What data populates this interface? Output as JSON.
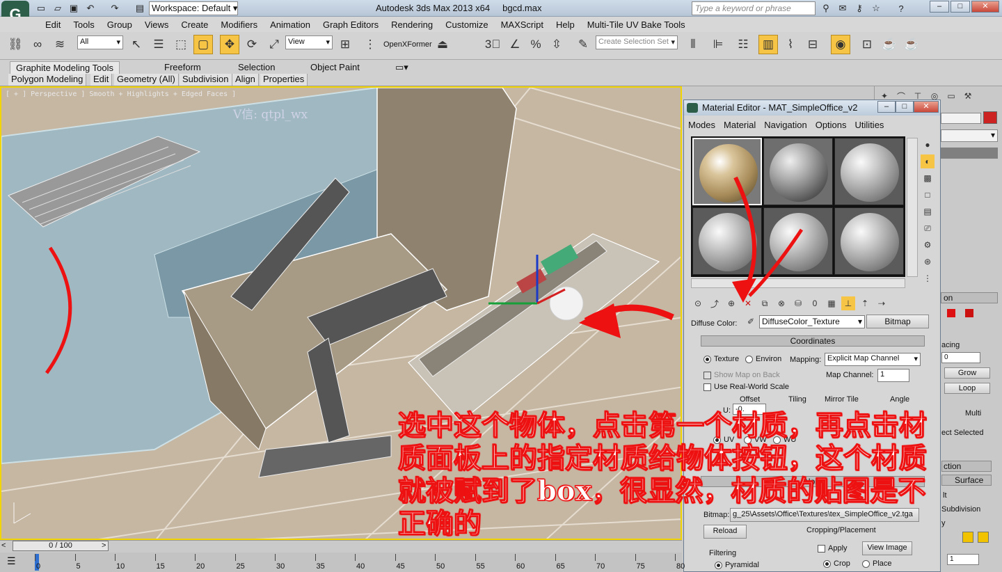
{
  "titlebar": {
    "workspace": "Workspace: Default",
    "app_title": "Autodesk 3ds Max  2013 x64",
    "file_name": "bgcd.max",
    "search_placeholder": "Type a keyword or phrase"
  },
  "menubar": [
    "Edit",
    "Tools",
    "Group",
    "Views",
    "Create",
    "Modifiers",
    "Animation",
    "Graph Editors",
    "Rendering",
    "Customize",
    "MAXScript",
    "Help",
    "Multi-Tile UV Bake Tools"
  ],
  "toolbar": {
    "selection_filter": "All",
    "ref_coord": "View",
    "openxformer": "OpenXFormer",
    "named_selection_placeholder": "Create Selection Set"
  },
  "ribbon": {
    "tabs": [
      "Graphite Modeling Tools",
      "Freeform",
      "Selection",
      "Object Paint"
    ],
    "subtabs": [
      "Polygon Modeling",
      "Edit",
      "Geometry (All)",
      "Subdivision",
      "Align",
      "Properties"
    ]
  },
  "viewport": {
    "label": "[ + ] Perspective ] Smooth + Highlights + Edged Faces ]",
    "watermark": "V信: qtpl_wx"
  },
  "material_editor": {
    "title": "Material Editor - MAT_SimpleOffice_v2",
    "menu": [
      "Modes",
      "Material",
      "Navigation",
      "Options",
      "Utilities"
    ],
    "diffuse_label": "Diffuse Color:",
    "map_name": "DiffuseColor_Texture",
    "map_type": "Bitmap",
    "coordinates_rollout": "Coordinates",
    "texture_label": "Texture",
    "environ_label": "Environ",
    "mapping_label": "Mapping:",
    "mapping_value": "Explicit Map Channel",
    "show_map_on_back": "Show Map on Back",
    "use_real_world": "Use Real-World Scale",
    "map_channel_label": "Map Channel:",
    "map_channel_value": "1",
    "col_offset": "Offset",
    "col_tiling": "Tiling",
    "col_mirror_tile": "Mirror Tile",
    "col_angle": "Angle",
    "u_label": "U:",
    "u_offset": "-0.",
    "uv_label": "UV",
    "vw_label": "VW",
    "wu_label": "WU",
    "noise_rollout": "Nois",
    "bitmap_label": "Bitmap:",
    "bitmap_path": "g_25\\Assets\\Office\\Textures\\tex_SimpleOffice_v2.tga",
    "reload_button": "Reload",
    "cropping_label": "Cropping/Placement",
    "apply_label": "Apply",
    "view_image_button": "View Image",
    "crop_label": "Crop",
    "place_label": "Place",
    "filtering_label": "Filtering",
    "pyramidal_label": "Pyramidal"
  },
  "command_panel": {
    "spacing_label": "acing",
    "spin_value": "0",
    "grow_button": "Grow",
    "loop_button": "Loop",
    "multi_label": "Multi",
    "ect_selected": "ect Selected",
    "section_a": "on",
    "ction": "ction",
    "surface": "Surface",
    "lt": "lt",
    "subdivision": "Subdivision",
    "y": "y",
    "bottom_value": "1"
  },
  "annotation": {
    "text": "选中这个物体，点击第一个材质，再点击材质面板上的指定材质给物体按钮，这个材质就被赋到了box，很显然，材质的贴图是不正确的"
  },
  "timeline": {
    "slider_label": "0 / 100",
    "ticks": [
      "0",
      "5",
      "10",
      "15",
      "20",
      "25",
      "30",
      "35",
      "40",
      "45",
      "50",
      "55",
      "60",
      "65",
      "70",
      "75",
      "80"
    ]
  },
  "colors": {
    "accent": "#f1d400",
    "annotation": "#e11111",
    "app_logo": "#2c5e49"
  }
}
